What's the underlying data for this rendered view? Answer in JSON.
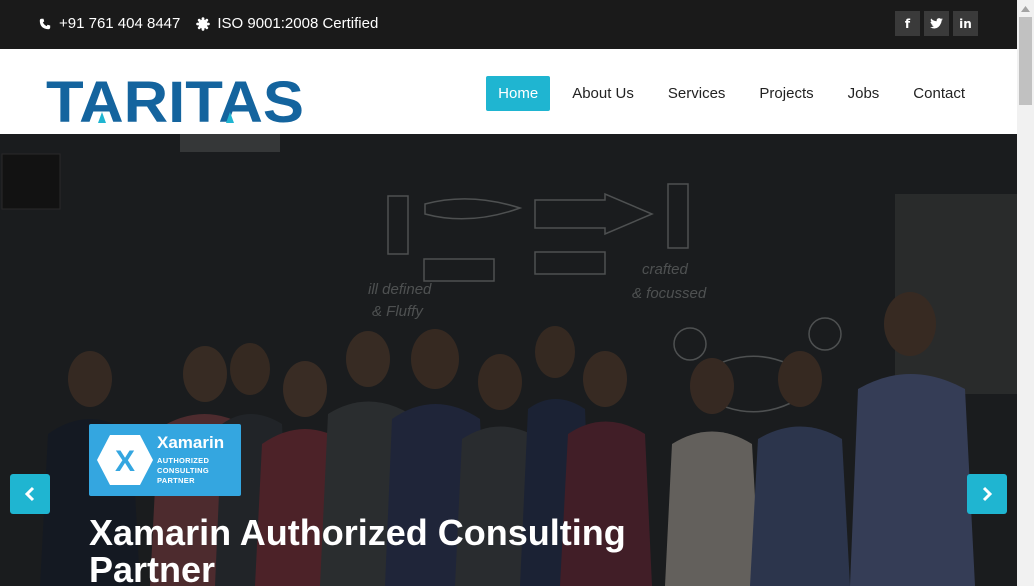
{
  "topbar": {
    "phone": "+91 761 404 8447",
    "certification": "ISO 9001:2008 Certified",
    "phone_icon": "phone-icon",
    "cert_icon": "certificate-icon",
    "social": [
      {
        "name": "facebook-icon",
        "glyph": "f"
      },
      {
        "name": "twitter-icon",
        "glyph": "t"
      },
      {
        "name": "linkedin-icon",
        "glyph": "in"
      }
    ]
  },
  "logo": {
    "text": "TARITAS",
    "color": "#14649e",
    "accent": "#1fb5d1"
  },
  "nav": {
    "items": [
      "Home",
      "About Us",
      "Services",
      "Projects",
      "Jobs",
      "Contact"
    ],
    "active": "Home",
    "accent": "#1fb5d1"
  },
  "hero": {
    "badge_brand": "Xamarin",
    "badge_lines": [
      "AUTHORIZED",
      "CONSULTING",
      "PARTNER"
    ],
    "badge_color": "#34a6e0",
    "caption": "Xamarin Authorized Consulting Partner",
    "prev_icon": "chevron-left-icon",
    "next_icon": "chevron-right-icon"
  }
}
